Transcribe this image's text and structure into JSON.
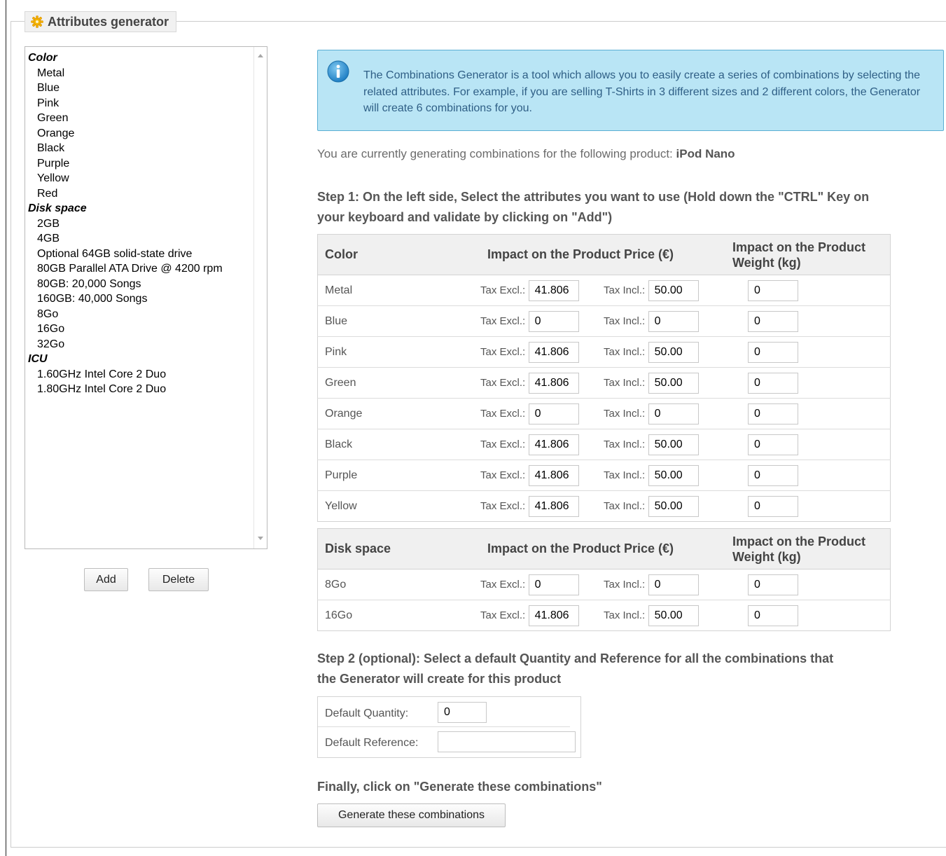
{
  "panel": {
    "title": "Attributes generator"
  },
  "attribute_list": {
    "groups": [
      {
        "name": "Color",
        "options": [
          "Metal",
          "Blue",
          "Pink",
          "Green",
          "Orange",
          "Black",
          "Purple",
          "Yellow",
          "Red"
        ]
      },
      {
        "name": "Disk space",
        "options": [
          "2GB",
          "4GB",
          "Optional 64GB solid-state drive",
          "80GB Parallel ATA Drive @ 4200 rpm",
          "80GB: 20,000 Songs",
          "160GB: 40,000 Songs",
          "8Go",
          "16Go",
          "32Go"
        ]
      },
      {
        "name": "ICU",
        "options": [
          "1.60GHz Intel Core 2 Duo",
          "1.80GHz Intel Core 2 Duo"
        ]
      }
    ]
  },
  "buttons": {
    "add": "Add",
    "delete": "Delete",
    "generate": "Generate these combinations"
  },
  "info_text": "The Combinations Generator is a tool which allows you to easily create a series of combinations by selecting the related attributes. For example, if you are selling T-Shirts in 3 different sizes and 2 different colors, the Generator will create 6 combinations for you.",
  "product_line": {
    "prefix": "You are currently generating combinations for the following product: ",
    "product": "iPod Nano"
  },
  "step1": "Step 1: On the left side, Select the attributes you want to use (Hold down the \"CTRL\" Key on your keyboard and validate by clicking on \"Add\")",
  "labels": {
    "tax_excl": "Tax Excl.:",
    "tax_incl": "Tax Incl.:"
  },
  "tables": [
    {
      "headers": [
        "Color",
        "Impact on the Product Price (€)",
        "Impact on the Product Weight (kg)"
      ],
      "rows": [
        {
          "name": "Metal",
          "excl": "41.806",
          "incl": "50.00",
          "weight": "0"
        },
        {
          "name": "Blue",
          "excl": "0",
          "incl": "0",
          "weight": "0"
        },
        {
          "name": "Pink",
          "excl": "41.806",
          "incl": "50.00",
          "weight": "0"
        },
        {
          "name": "Green",
          "excl": "41.806",
          "incl": "50.00",
          "weight": "0"
        },
        {
          "name": "Orange",
          "excl": "0",
          "incl": "0",
          "weight": "0"
        },
        {
          "name": "Black",
          "excl": "41.806",
          "incl": "50.00",
          "weight": "0"
        },
        {
          "name": "Purple",
          "excl": "41.806",
          "incl": "50.00",
          "weight": "0"
        },
        {
          "name": "Yellow",
          "excl": "41.806",
          "incl": "50.00",
          "weight": "0"
        }
      ]
    },
    {
      "headers": [
        "Disk space",
        "Impact on the Product Price (€)",
        "Impact on the Product Weight (kg)"
      ],
      "rows": [
        {
          "name": "8Go",
          "excl": "0",
          "incl": "0",
          "weight": "0"
        },
        {
          "name": "16Go",
          "excl": "41.806",
          "incl": "50.00",
          "weight": "0"
        }
      ]
    }
  ],
  "step2": "Step 2 (optional): Select a default Quantity and Reference for all the combinations that the Generator will create for this product",
  "defaults": {
    "quantity_label": "Default Quantity:",
    "quantity_value": "0",
    "reference_label": "Default Reference:",
    "reference_value": ""
  },
  "final_text": "Finally, click on \"Generate these combinations\"",
  "colors": {
    "info_bg": "#b9e5f5",
    "info_border": "#5aafd4",
    "info_text": "#2f5f86",
    "header_bg": "#f0f0f0"
  }
}
